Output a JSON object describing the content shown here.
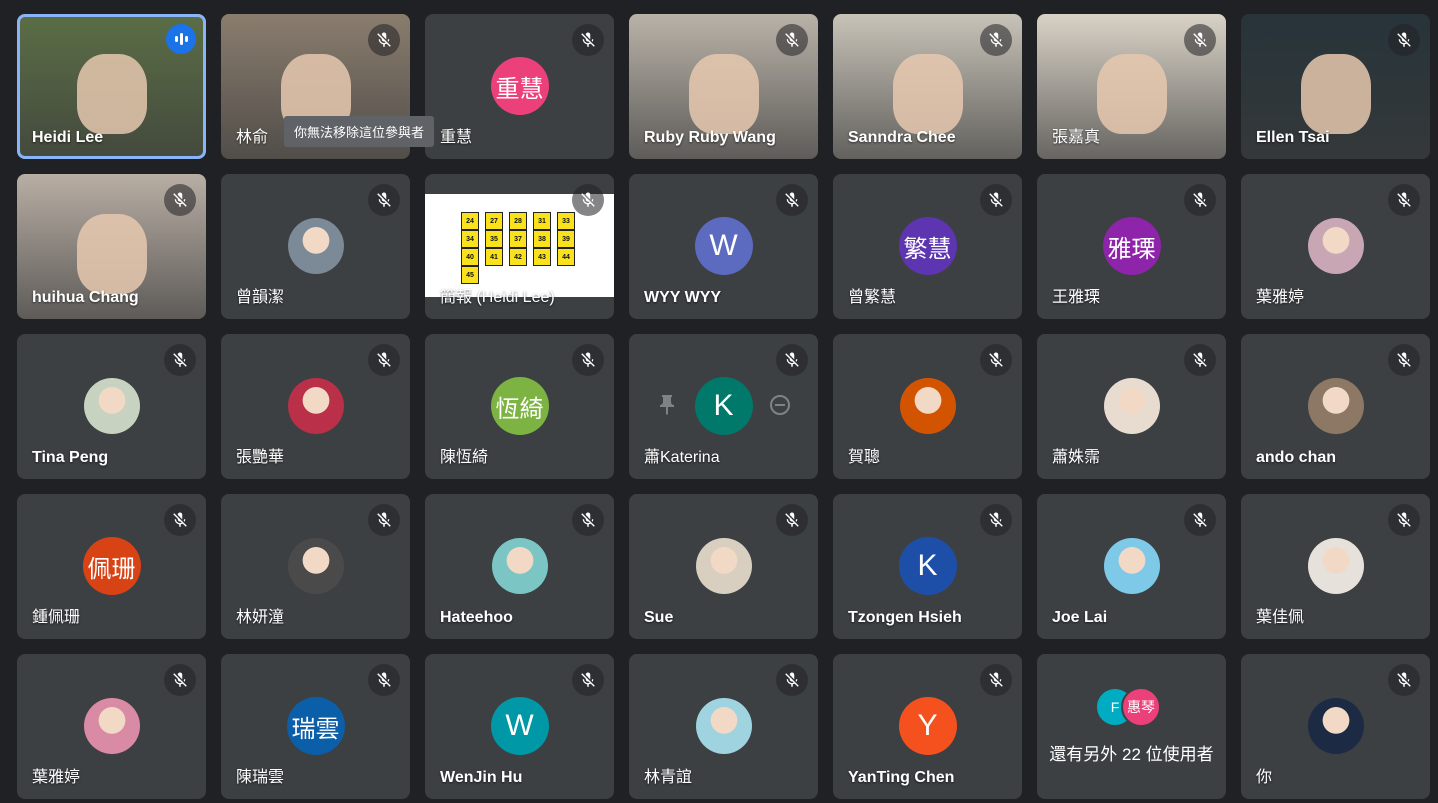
{
  "tooltip": "你無法移除這位參與者",
  "participants": [
    {
      "name": "Heidi Lee",
      "kind": "video",
      "speaking": true,
      "bg": "#5b6e46"
    },
    {
      "name": "林俞",
      "kind": "video",
      "bg": "#8a7d6e"
    },
    {
      "name": "重慧",
      "initials": "重慧",
      "kind": "initials",
      "color": "#ec407a",
      "name_visible": "重慧"
    },
    {
      "name": "Ruby Ruby Wang",
      "kind": "video",
      "bg": "#b9b2a8"
    },
    {
      "name": "Sanndra Chee",
      "kind": "video",
      "bg": "#c8c3b8"
    },
    {
      "name": "張嘉真",
      "kind": "video",
      "bg": "#d9d2c6"
    },
    {
      "name": "Ellen Tsai",
      "kind": "video",
      "bg": "#27343a"
    },
    {
      "name": "huihua Chang",
      "kind": "video",
      "bg": "#b8aea4"
    },
    {
      "name": "曾韻潔",
      "kind": "photo",
      "color": "#7b8a96"
    },
    {
      "name": "簡報 (Heidi Lee)",
      "kind": "presentation"
    },
    {
      "name": "WYY WYY",
      "initials": "W",
      "kind": "initials",
      "color": "#5c6bc0"
    },
    {
      "name": "曾繁慧",
      "initials": "繁慧",
      "kind": "initials",
      "color": "#5e35b1"
    },
    {
      "name": "王雅瑮",
      "initials": "雅瑮",
      "kind": "initials",
      "color": "#8e24aa"
    },
    {
      "name": "葉雅婷",
      "kind": "photo",
      "color": "#c9a6b4"
    },
    {
      "name": "Tina Peng",
      "kind": "photo",
      "color": "#c7d3c0"
    },
    {
      "name": "張艷華",
      "kind": "photo",
      "color": "#b93048"
    },
    {
      "name": "陳恆綺",
      "initials": "恆綺",
      "kind": "initials",
      "color": "#7cb342"
    },
    {
      "name": "蕭Katerina",
      "initials": "K",
      "kind": "initials",
      "color": "#00796b",
      "hover": true
    },
    {
      "name": "賀聰",
      "kind": "photo",
      "color": "#d35400"
    },
    {
      "name": "蕭姝霈",
      "kind": "photo",
      "color": "#e8dcd0"
    },
    {
      "name": "ando chan",
      "kind": "photo",
      "color": "#8d7865"
    },
    {
      "name": "鍾佩珊",
      "initials": "佩珊",
      "kind": "initials",
      "color": "#d84315"
    },
    {
      "name": "林妍潼",
      "kind": "photo",
      "color": "#4a4a4a"
    },
    {
      "name": "Hateehoo",
      "kind": "photo",
      "color": "#7bc6c4"
    },
    {
      "name": "Sue",
      "kind": "photo",
      "color": "#d8cfc0"
    },
    {
      "name": "Tzongen Hsieh",
      "initials": "K",
      "kind": "initials",
      "color": "#1e4fa8"
    },
    {
      "name": "Joe Lai",
      "kind": "photo",
      "color": "#7ec8e8"
    },
    {
      "name": "葉佳佩",
      "kind": "photo",
      "color": "#e6e1da"
    },
    {
      "name": "葉雅婷",
      "kind": "photo",
      "color": "#d98aa4"
    },
    {
      "name": "陳瑞雲",
      "initials": "瑞雲",
      "kind": "initials",
      "color": "#0b5ea8"
    },
    {
      "name": "WenJin Hu",
      "initials": "W",
      "kind": "initials",
      "color": "#0097a7"
    },
    {
      "name": "林青誼",
      "kind": "photo",
      "color": "#9fd3df"
    },
    {
      "name": "YanTing Chen",
      "initials": "Y",
      "kind": "initials",
      "color": "#f4511e"
    },
    {
      "name": "還有另外 22 位使用者",
      "kind": "more",
      "bubbles": [
        {
          "label": "F",
          "color": "#00acc1"
        },
        {
          "label": "惠琴",
          "color": "#ec407a"
        }
      ]
    },
    {
      "name": "你",
      "kind": "photo",
      "color": "#1c2a44"
    }
  ],
  "slide_numbers": [
    "24",
    "27",
    "28",
    "31",
    "33",
    "34",
    "35",
    "37",
    "38",
    "39",
    "40",
    "41",
    "42",
    "43",
    "44",
    "45"
  ],
  "colors": {
    "tile": "#3c4043",
    "background": "#202124",
    "active_outline": "#8ab4f8"
  }
}
